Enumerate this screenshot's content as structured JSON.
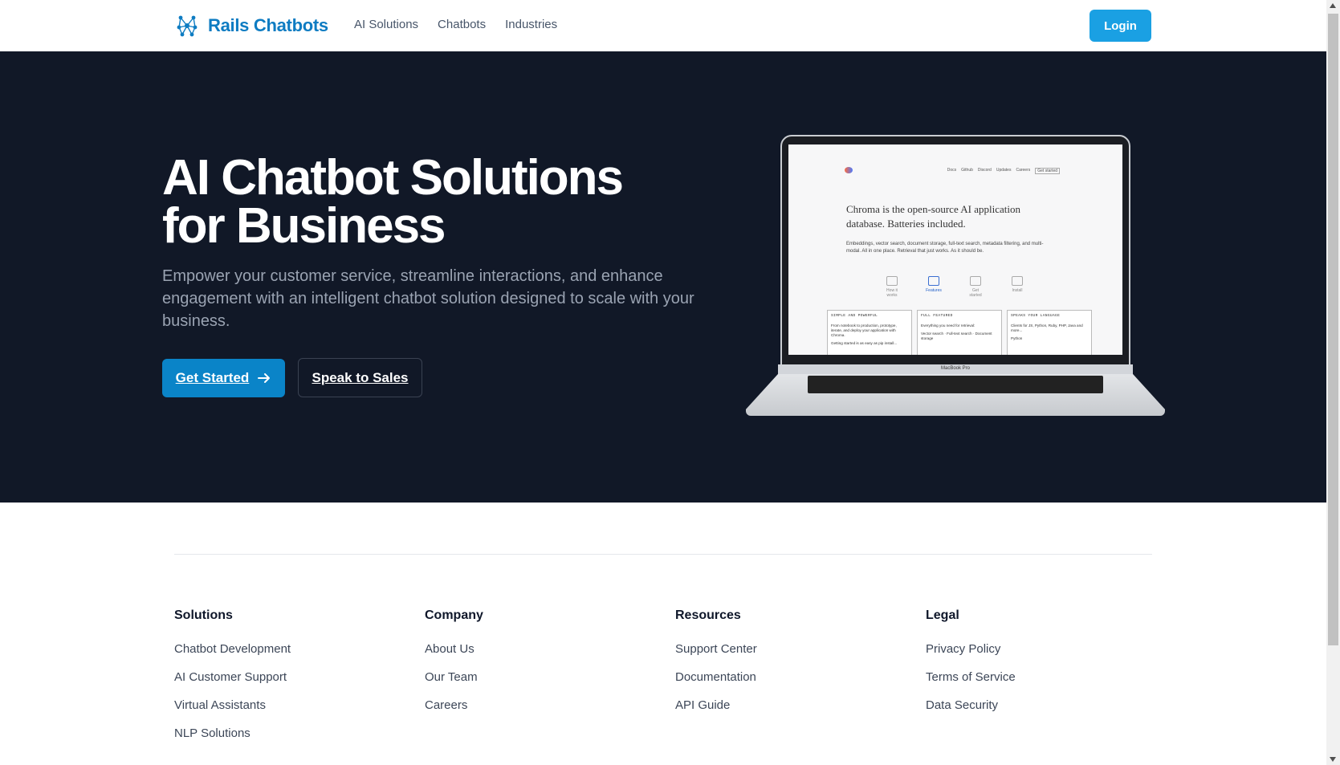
{
  "header": {
    "brand_name": "Rails Chatbots",
    "logo_icon": "network-nodes-icon",
    "nav": [
      "AI Solutions",
      "Chatbots",
      "Industries"
    ],
    "login_label": "Login"
  },
  "hero": {
    "title_line1": "AI Chatbot Solutions",
    "title_line2": "for Business",
    "subtitle": "Empower your customer service, streamline interactions, and enhance engagement with an intelligent chatbot solution designed to scale with your business.",
    "primary_cta": "Get Started",
    "primary_cta_icon": "arrow-right-icon",
    "secondary_cta": "Speak to Sales"
  },
  "mockup": {
    "nav_links": [
      "Docs",
      "Github",
      "Discord",
      "Updates",
      "Careers",
      "Get started"
    ],
    "headline": "Chroma is the open-source AI application database. Batteries included.",
    "body": "Embeddings, vector search, document storage, full-text search, metadata filtering, and multi-modal. All in one place. Retrieval that just works. As it should be.",
    "icons": [
      "How it works",
      "Features",
      "Get started",
      "Install"
    ],
    "cards": [
      {
        "title": "SIMPLE AND POWERFUL",
        "text": "From notebook to production, prototype, iterate, and deploy your application with Chroma.",
        "text2": "Getting started is as easy as pip install..."
      },
      {
        "title": "FULL FEATURED",
        "text": "Everything you need for retrieval:",
        "text2": "Vector search · Full-text search · Document storage"
      },
      {
        "title": "SPEAKS YOUR LANGUAGE",
        "text": "Clients for JS, Python, Ruby, PHP, Java and more...",
        "text2": "Python"
      }
    ],
    "device_label": "MacBook Pro"
  },
  "footer": {
    "columns": [
      {
        "title": "Solutions",
        "links": [
          "Chatbot Development",
          "AI Customer Support",
          "Virtual Assistants",
          "NLP Solutions"
        ]
      },
      {
        "title": "Company",
        "links": [
          "About Us",
          "Our Team",
          "Careers"
        ]
      },
      {
        "title": "Resources",
        "links": [
          "Support Center",
          "Documentation",
          "API Guide"
        ]
      },
      {
        "title": "Legal",
        "links": [
          "Privacy Policy",
          "Terms of Service",
          "Data Security"
        ]
      }
    ]
  },
  "colors": {
    "brand": "#0e7cc2",
    "login_bg": "#1aa0e3",
    "hero_bg": "#111827",
    "primary_btn": "#0a84c8"
  }
}
